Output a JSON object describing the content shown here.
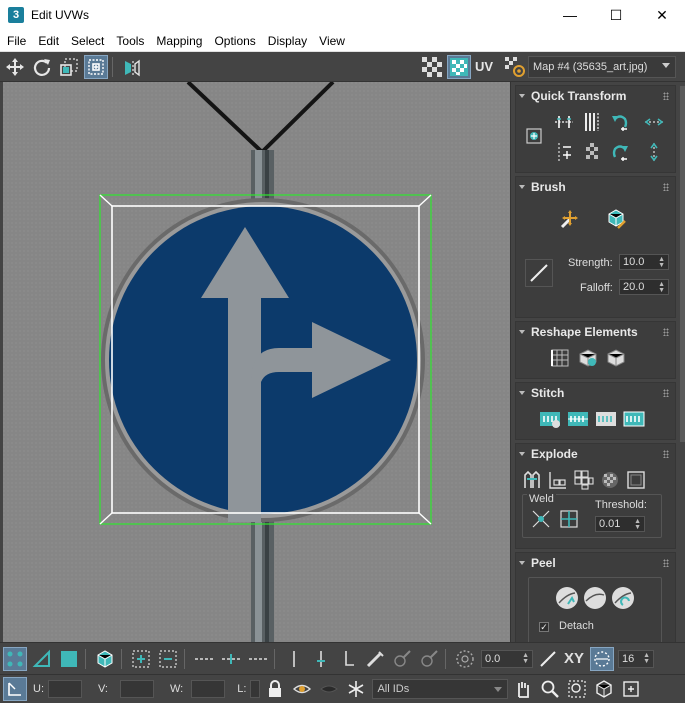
{
  "window": {
    "title": "Edit UVWs",
    "app_icon_text": "3",
    "minimize_glyph": "—",
    "maximize_glyph": "☐",
    "close_glyph": "✕"
  },
  "menu": {
    "items": [
      {
        "label": "File"
      },
      {
        "label": "Edit"
      },
      {
        "label": "Select"
      },
      {
        "label": "Tools"
      },
      {
        "label": "Mapping"
      },
      {
        "label": "Options"
      },
      {
        "label": "Display"
      },
      {
        "label": "View"
      }
    ]
  },
  "toolbar_top": {
    "uv_label": "UV",
    "map_selector": "Map #4 (35635_art.jpg)"
  },
  "panel": {
    "quick_transform": {
      "title": "Quick Transform"
    },
    "brush": {
      "title": "Brush",
      "strength_label": "Strength:",
      "strength_value": "10.0",
      "falloff_label": "Falloff:",
      "falloff_value": "20.0"
    },
    "reshape": {
      "title": "Reshape Elements"
    },
    "stitch": {
      "title": "Stitch"
    },
    "explode": {
      "title": "Explode",
      "weld_label": "Weld",
      "threshold_label": "Threshold:",
      "threshold_value": "0.01"
    },
    "peel": {
      "title": "Peel",
      "detach_label": "Detach",
      "detach_checked": true
    }
  },
  "bottom_bar": {
    "angle_value": "0.0",
    "xy_label": "XY",
    "pixel_value": "16",
    "u_label": "U:",
    "v_label": "V:",
    "w_label": "W:",
    "l_label": "L:",
    "id_filter": "All IDs"
  },
  "colors": {
    "accent_teal": "#3fb8b8",
    "sign_blue": "#0c3a6b",
    "background_gray": "#858585",
    "selection_green": "#2ee82e"
  }
}
